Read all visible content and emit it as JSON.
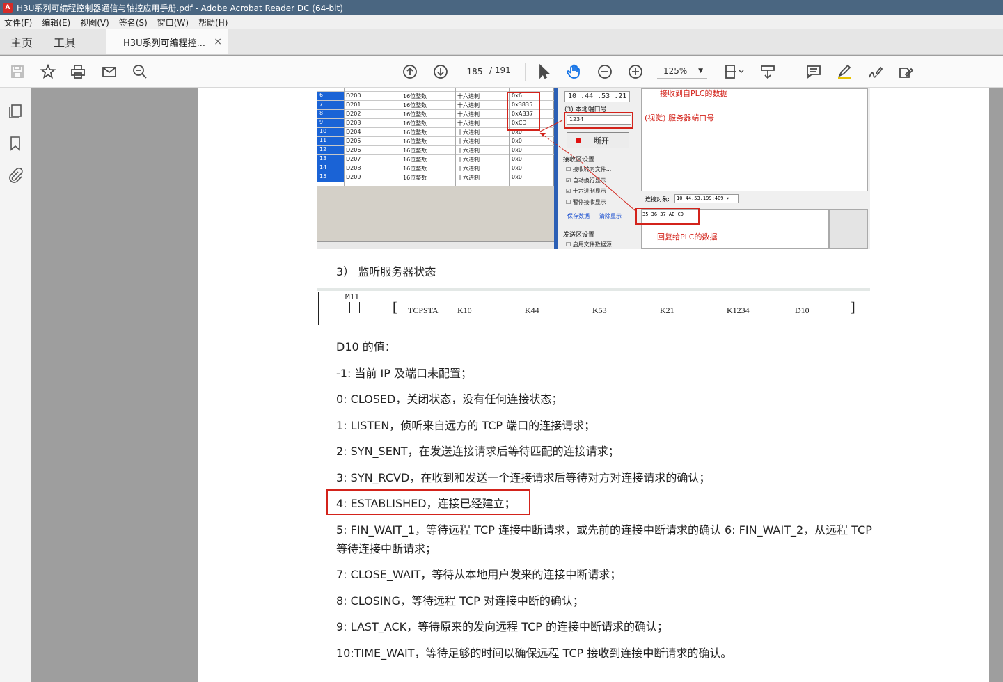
{
  "window": {
    "title": "H3U系列可编程控制器通信与轴控应用手册.pdf - Adobe Acrobat Reader DC (64-bit)"
  },
  "menu": [
    "文件(F)",
    "编辑(E)",
    "视图(V)",
    "签名(S)",
    "窗口(W)",
    "帮助(H)"
  ],
  "tabs": {
    "home": "主页",
    "tools": "工具",
    "document": "H3U系列可编程控...",
    "close": "×"
  },
  "toolbar": {
    "page_current": "185",
    "page_total": "/ 191",
    "zoom": "125%"
  },
  "screenshot": {
    "rows": [
      {
        "idx": "6",
        "addr": "D200",
        "type": "16位整数",
        "fmt": "十六进制",
        "val": "0x6"
      },
      {
        "idx": "7",
        "addr": "D201",
        "type": "16位整数",
        "fmt": "十六进制",
        "val": "0x3835"
      },
      {
        "idx": "8",
        "addr": "D202",
        "type": "16位整数",
        "fmt": "十六进制",
        "val": "0xAB37"
      },
      {
        "idx": "9",
        "addr": "D203",
        "type": "16位整数",
        "fmt": "十六进制",
        "val": "0xCD"
      },
      {
        "idx": "10",
        "addr": "D204",
        "type": "16位整数",
        "fmt": "十六进制",
        "val": "0x0"
      },
      {
        "idx": "11",
        "addr": "D205",
        "type": "16位整数",
        "fmt": "十六进制",
        "val": "0x0"
      },
      {
        "idx": "12",
        "addr": "D206",
        "type": "16位整数",
        "fmt": "十六进制",
        "val": "0x0"
      },
      {
        "idx": "13",
        "addr": "D207",
        "type": "16位整数",
        "fmt": "十六进制",
        "val": "0x0"
      },
      {
        "idx": "14",
        "addr": "D208",
        "type": "16位整数",
        "fmt": "十六进制",
        "val": "0x0"
      },
      {
        "idx": "15",
        "addr": "D209",
        "type": "16位整数",
        "fmt": "十六进制",
        "val": "0x0"
      }
    ],
    "ip": "10 .44 .53 .21",
    "local_port_label": "(3) 本地端口号",
    "port": "1234",
    "disconnect": "断开",
    "recv_settings": "接收区设置",
    "recv_to_file": "接收转向文件...",
    "auto_newline": "自动换行显示",
    "hex_display": "十六进制显示",
    "pause_recv": "暂停接收显示",
    "save_data": "保存数据",
    "clear_display": "清除显示",
    "send_settings": "发送区设置",
    "enable_file": "启用文件数据源...",
    "conn_target_label": "连接对象:",
    "conn_target": "10.44.53.199:409",
    "send_data": "35 36 37 AB CD",
    "ann_recv": "接收到自PLC的数据",
    "ann_port": "(视觉) 服务器端口号",
    "ann_reply": "回复给PLC的数据"
  },
  "content": {
    "heading": "3）  监听服务器状态",
    "ladder": {
      "contact": "M11",
      "instr": "TCPSTA",
      "a1": "K10",
      "a2": "K44",
      "a3": "K53",
      "a4": "K21",
      "a5": "K1234",
      "a6": "D10",
      "end": "]"
    },
    "lines": [
      "D10 的值：",
      "-1: 当前 IP 及端口未配置；",
      "0: CLOSED，关闭状态，没有任何连接状态；",
      "1: LISTEN，侦听来自远方的 TCP 端口的连接请求；",
      "2: SYN_SENT，在发送连接请求后等待匹配的连接请求；",
      "3: SYN_RCVD，在收到和发送一个连接请求后等待对方对连接请求的确认；",
      "4: ESTABLISHED，连接已经建立；",
      "5: FIN_WAIT_1，等待远程 TCP 连接中断请求，或先前的连接中断请求的确认 6: FIN_WAIT_2，从远程 TCP",
      "等待连接中断请求；",
      "7: CLOSE_WAIT，等待从本地用户发来的连接中断请求；",
      "8: CLOSING，等待远程 TCP 对连接中断的确认；",
      "9: LAST_ACK，等待原来的发向远程 TCP 的连接中断请求的确认；",
      "10:TIME_WAIT，等待足够的时间以确保远程 TCP 接收到连接中断请求的确认。"
    ]
  }
}
